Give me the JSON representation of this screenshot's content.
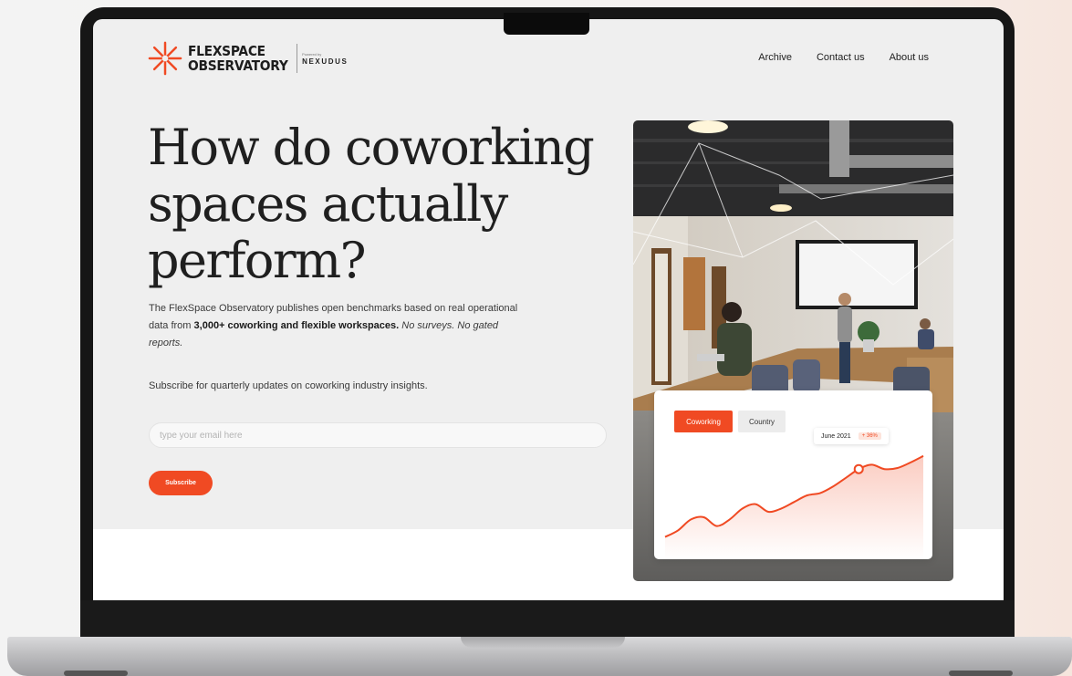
{
  "brand": {
    "name_line1": "FLEXSPACE",
    "name_line2": "OBSERVATORY",
    "partner_prefix": "Powered by",
    "partner_name": "NEXUDUS",
    "accent_color": "#f04a23"
  },
  "nav": {
    "items": [
      {
        "label": "Archive"
      },
      {
        "label": "Contact us"
      },
      {
        "label": "About us"
      }
    ]
  },
  "hero": {
    "title": "How do coworking spaces actually perform?",
    "desc_part1": "The FlexSpace Observatory publishes open benchmarks based on real operational data from ",
    "desc_bold": "3,000+ coworking and flexible workspaces.",
    "desc_italic": "No surveys. No gated reports.",
    "subscribe_copy": "Subscribe for quarterly updates on coworking industry insights.",
    "email_placeholder": "type your email here",
    "email_value": "",
    "subscribe_label": "Subscribe"
  },
  "chart_card": {
    "tabs": [
      {
        "label": "Coworking",
        "active": true
      },
      {
        "label": "Country",
        "active": false
      }
    ],
    "tooltip_date": "June 2021",
    "tooltip_change": "+ 36%"
  },
  "chart_data": {
    "type": "area",
    "x": [
      0,
      1,
      2,
      3,
      4,
      5,
      6,
      7,
      8,
      9,
      10,
      11,
      12,
      13,
      14,
      15,
      16,
      17,
      18,
      19,
      20
    ],
    "series": [
      {
        "values": [
          12,
          18,
          28,
          30,
          22,
          28,
          38,
          42,
          35,
          38,
          44,
          50,
          52,
          58,
          66,
          74,
          78,
          74,
          75,
          80,
          86
        ]
      }
    ],
    "ylim": [
      0,
      100
    ],
    "highlight_index": 15,
    "line_color": "#f04a23"
  }
}
